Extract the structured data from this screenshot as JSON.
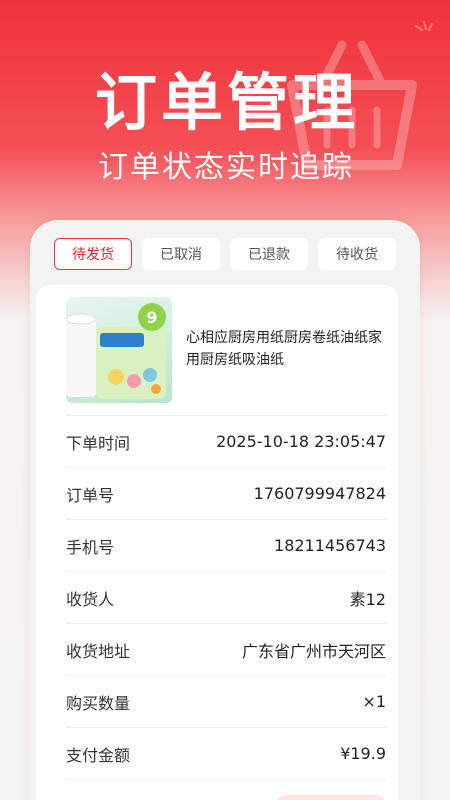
{
  "hero": {
    "title": "订单管理",
    "subtitle": "订单状态实时追踪"
  },
  "tabs": [
    {
      "label": "待发货",
      "active": true
    },
    {
      "label": "已取消",
      "active": false
    },
    {
      "label": "已退款",
      "active": false
    },
    {
      "label": "待收货",
      "active": false
    }
  ],
  "product": {
    "name": "心相应厨房用纸厨房卷纸油纸家用厨房纸吸油纸",
    "image_icon": "kitchen-paper-roll-image",
    "image_badge": "9"
  },
  "order_details": [
    {
      "label": "下单时间",
      "value": "2025-10-18 23:05:47"
    },
    {
      "label": "订单号",
      "value": "1760799947824"
    },
    {
      "label": "手机号",
      "value": "18211456743"
    },
    {
      "label": "收货人",
      "value": "素12"
    },
    {
      "label": "收货地址",
      "value": "广东省广州市天河区"
    },
    {
      "label": "购买数量",
      "value": "×1"
    },
    {
      "label": "支付金额",
      "value": "¥19.9"
    }
  ],
  "colors": {
    "brand_red": "#f0313a",
    "active_tab_border": "#e8383d"
  }
}
